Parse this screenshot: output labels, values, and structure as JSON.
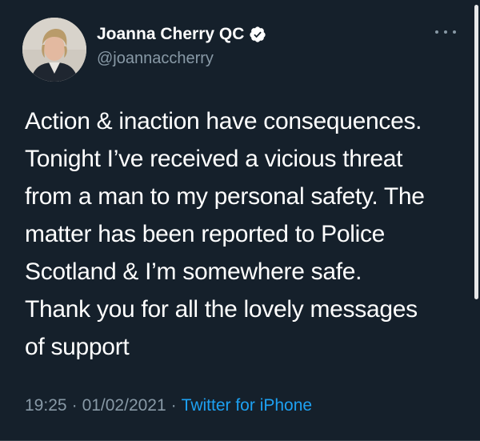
{
  "author": {
    "display_name": "Joanna Cherry QC",
    "handle": "@joannaccherry",
    "verified": true,
    "avatar": "profile-photo"
  },
  "tweet": {
    "lines": [
      "Action & inaction have consequences.",
      "Tonight I’ve received a vicious threat",
      "from a man to my personal safety. The",
      "matter has been reported to Police",
      "Scotland & I’m somewhere safe.",
      "Thank you for all the lovely messages",
      "of support"
    ],
    "time": "19:25",
    "date": "01/02/2021",
    "separator": "·",
    "source": "Twitter for iPhone"
  },
  "icons": {
    "more": "more-options-icon",
    "verified": "verified-badge-icon"
  },
  "colors": {
    "background": "#15202b",
    "text": "#ffffff",
    "secondary_text": "#8899a6",
    "accent": "#1da1f2"
  }
}
